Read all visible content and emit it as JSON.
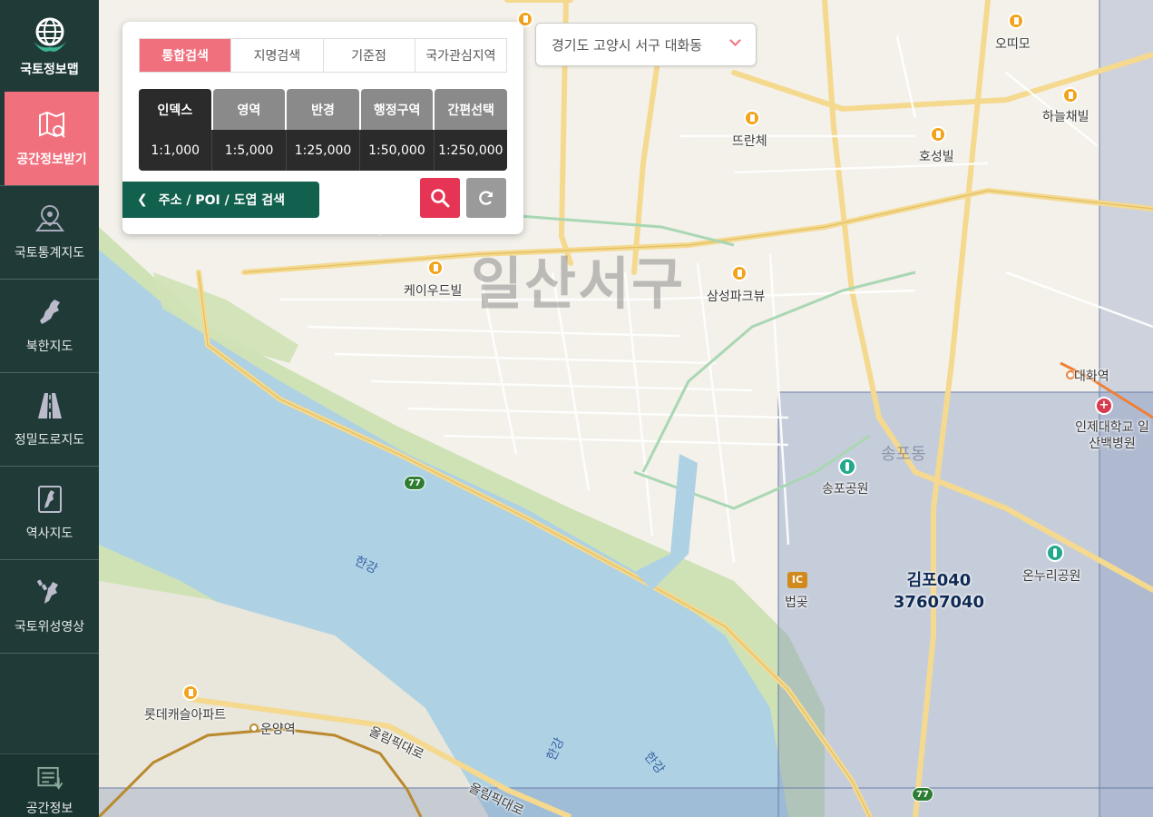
{
  "app": {
    "logo_text": "국토정보맵"
  },
  "sidebar": {
    "items": [
      {
        "label": "공간정보받기",
        "icon": "map-download-icon",
        "active": true
      },
      {
        "label": "국토통계지도",
        "icon": "map-pin-icon"
      },
      {
        "label": "북한지도",
        "icon": "north-korea-icon"
      },
      {
        "label": "정밀도로지도",
        "icon": "road-icon"
      },
      {
        "label": "역사지도",
        "icon": "history-map-icon"
      },
      {
        "label": "국토위성영상",
        "icon": "satellite-icon"
      }
    ],
    "bottom_label": "공간정보"
  },
  "search_panel": {
    "tabs": [
      "통합검색",
      "지명검색",
      "기준점",
      "국가관심지역"
    ],
    "active_tab": "통합검색",
    "modes": [
      "인덱스",
      "영역",
      "반경",
      "행정구역",
      "간편선택"
    ],
    "active_mode": "인덱스",
    "scales": [
      "1:1,000",
      "1:5,000",
      "1:25,000",
      "1:50,000",
      "1:250,000"
    ],
    "address_button": "주소 / POI / 도엽 검색"
  },
  "location": {
    "value": "경기도 고양시 서구 대화동"
  },
  "map": {
    "district_label": "일산서구",
    "grid_label_line1": "김포040",
    "grid_label_line2": "37607040",
    "pois": {
      "p1": "오띠모",
      "p2": "하늘채빌",
      "p3": "뜨란체",
      "p4": "호성빌",
      "p5": "케이우드빌",
      "p6": "삼성파크뷰",
      "p7": "대화역",
      "p8": "인제대학교 일산백병원",
      "p9": "송포공원",
      "p10": "온누리공원",
      "p11": "법곶",
      "p12": "롯데캐슬아파트",
      "p13": "운양역",
      "p14": "송포동",
      "p15": "올림픽대로",
      "p16": "올림픽대로"
    },
    "river_label": "한강",
    "highway_number": "77",
    "ic_label": "IC",
    "hospital_symbol": "+"
  }
}
